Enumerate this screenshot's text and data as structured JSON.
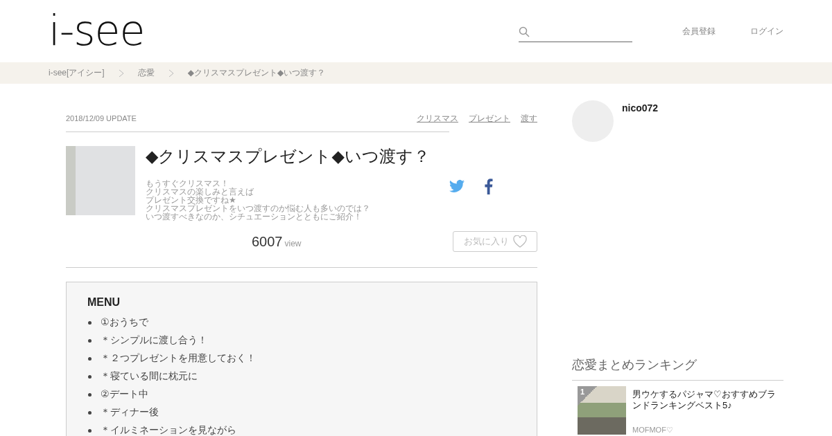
{
  "header": {
    "logo": "i-see",
    "nav_links": [
      "会員登録",
      "ログイン"
    ]
  },
  "breadcrumbs": [
    "i-see[アイシー]",
    "恋愛",
    "◆クリスマスプレゼント◆いつ渡す？"
  ],
  "article": {
    "date": "2018/12/09 UPDATE",
    "tags": [
      "クリスマス",
      "プレゼント",
      "渡す"
    ],
    "title": "◆クリスマスプレゼント◆いつ渡す？",
    "description": [
      "もうすぐクリスマス！",
      "クリスマスの楽しみと言えば",
      "プレゼント交換ですね★",
      "クリスマスプレゼントをいつ渡すのか悩む人も多いのでは？",
      "いつ渡すべきなのか、シチュエーションとともにご紹介！"
    ],
    "view_count": "6007",
    "view_label": "view",
    "favorite_button": "お気に入り"
  },
  "menu": {
    "heading": "MENU",
    "items": [
      "①おうちで",
      "＊シンプルに渡し合う！",
      "＊２つプレゼントを用意しておく！",
      "＊寝ている間に枕元に",
      "②デート中",
      "＊ディナー後",
      "＊イルミネーションを見ながら"
    ]
  },
  "sidebar": {
    "author": "nico072",
    "ranking": {
      "heading": "恋愛まとめランキング",
      "items": [
        {
          "rank": "1",
          "title": "男ウケするパジャマ♡おすすめブランドランキングベスト5♪",
          "author": "MOFMOF♡"
        }
      ]
    }
  }
}
